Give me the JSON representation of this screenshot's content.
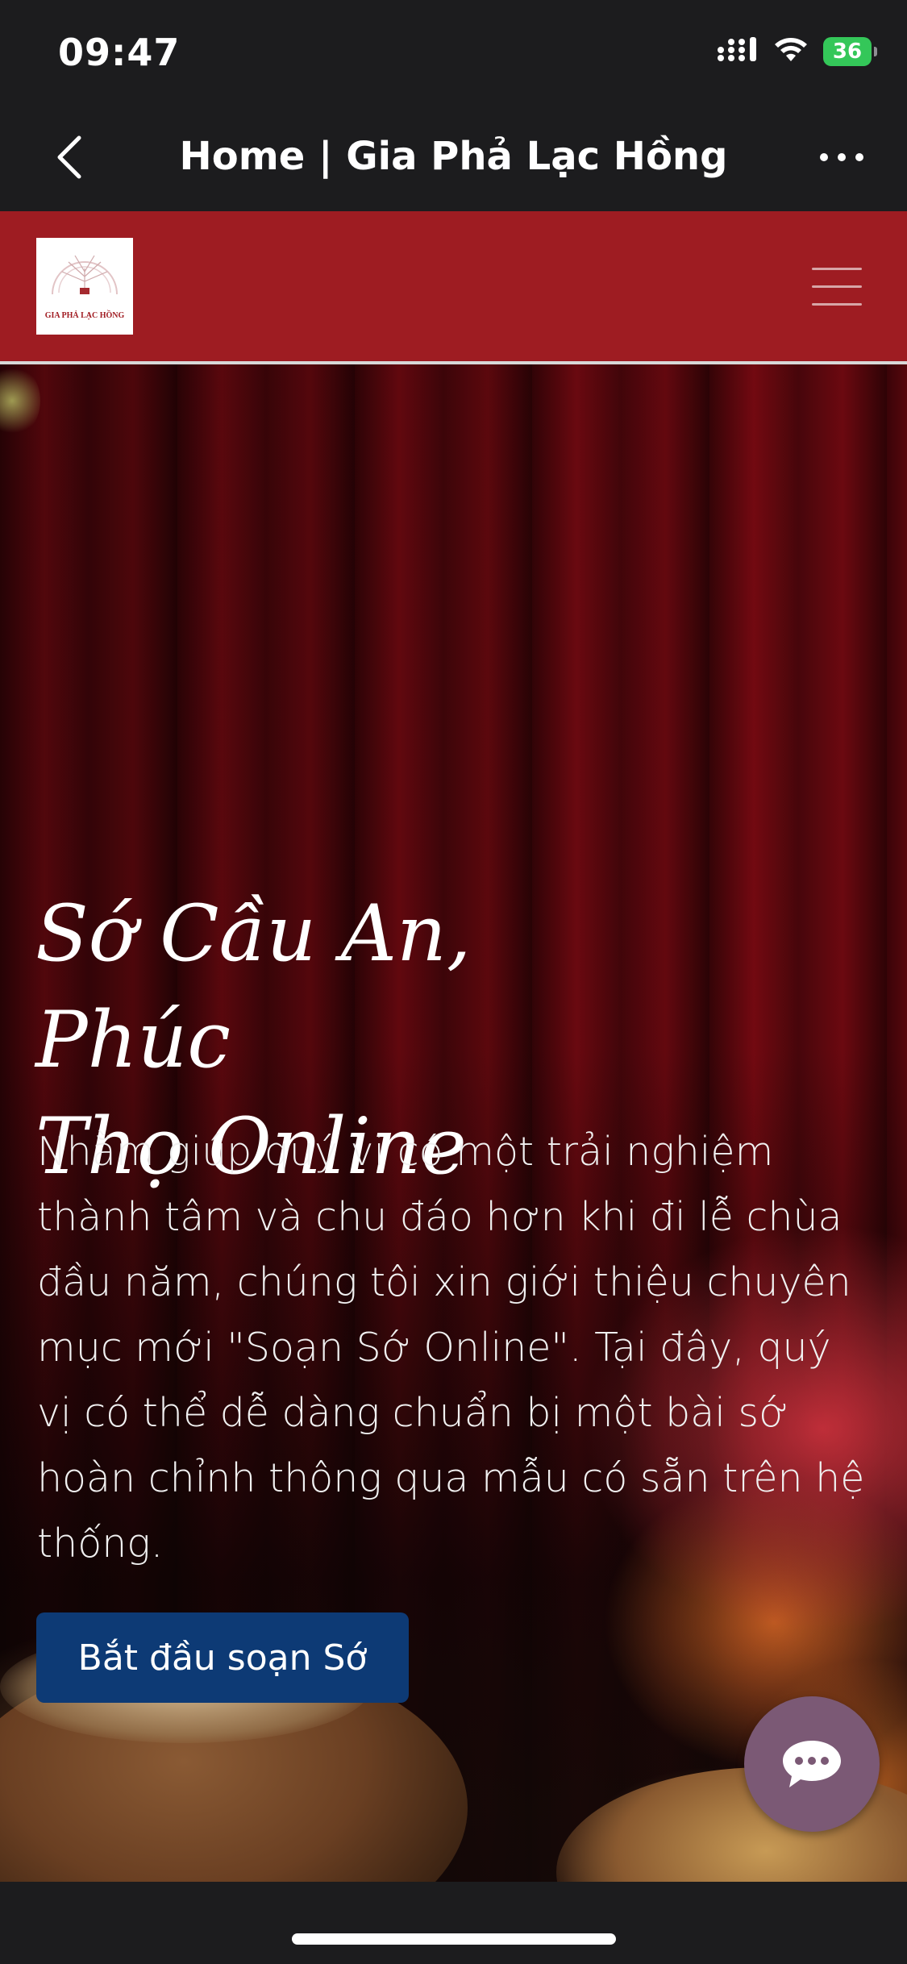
{
  "status_bar": {
    "time": "09:47",
    "battery": "36"
  },
  "nav_bar": {
    "title": "Home | Gia Phả Lạc Hồng",
    "back_icon": "chevron-left-icon",
    "more_icon": "ellipsis-icon"
  },
  "site_header": {
    "logo_text": "GIA PHẢ LẠC HỒNG",
    "menu_icon": "hamburger-menu-icon",
    "background_color": "#9e1c22"
  },
  "hero": {
    "title_line1": "Sớ Cầu An, Phúc",
    "title_line2": "Thọ Online",
    "description": "Nhằm giúp quý vị có một trải nghiệm thành tâm và chu đáo hơn khi đi lễ chùa đầu năm, chúng tôi xin giới thiệu chuyên mục mới \"Soạn Sớ Online\". Tại đây, quý vị có thể dễ dàng chuẩn bị một bài sớ hoàn chỉnh thông qua mẫu có sẵn trên hệ thống.",
    "cta_label": "Bắt đầu soạn Sớ",
    "cta_color": "#0d3a75"
  },
  "chat_button": {
    "icon": "chat-bubble-icon",
    "color": "#7b5975"
  }
}
